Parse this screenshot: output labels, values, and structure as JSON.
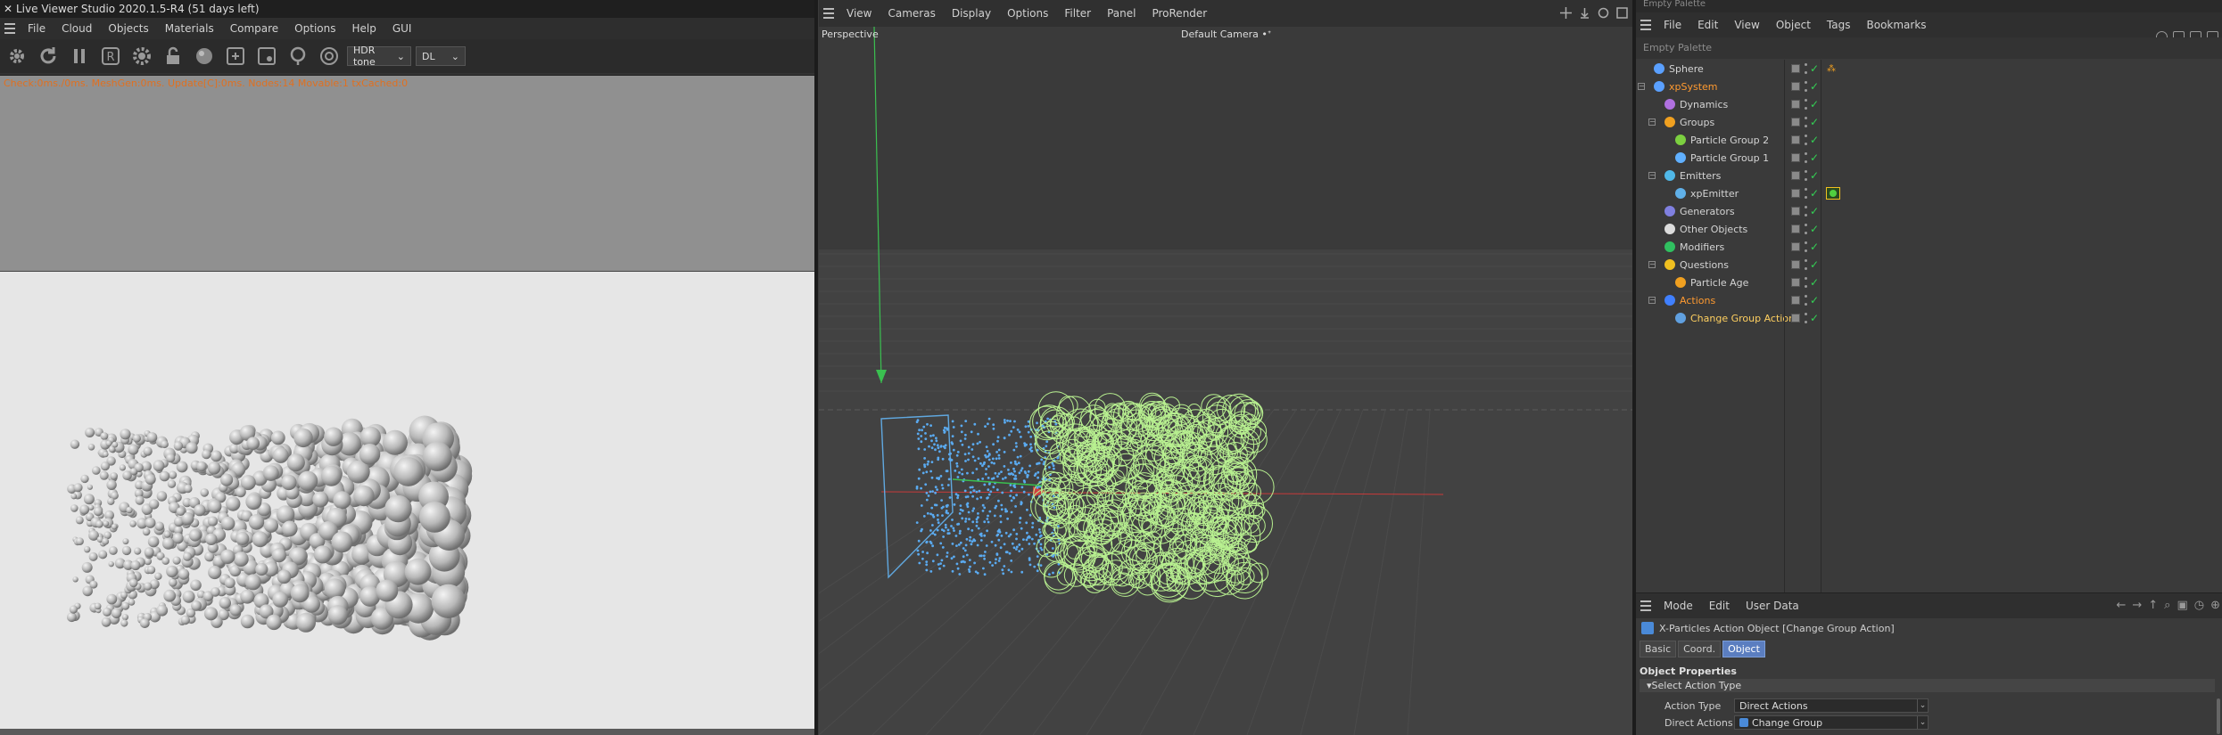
{
  "live_viewer": {
    "title": "Live Viewer Studio 2020.1.5-R4 (51 days left)",
    "menu": [
      "File",
      "Cloud",
      "Objects",
      "Materials",
      "Compare",
      "Options",
      "Help",
      "GUI"
    ],
    "tone_dropdown": "HDR tone",
    "mode_dropdown": "DL",
    "status": "Check:0ms./0ms. MeshGen:0ms. Update[C]:0ms. Nodes:14 Movable:1 txCached:0"
  },
  "viewport": {
    "menu": [
      "View",
      "Cameras",
      "Display",
      "Options",
      "Filter",
      "Panel",
      "ProRender"
    ],
    "projection": "Perspective",
    "camera": "Default Camera"
  },
  "object_manager": {
    "top_palette": "Empty Palette",
    "menu": [
      "File",
      "Edit",
      "View",
      "Object",
      "Tags",
      "Bookmarks"
    ],
    "palette": "Empty Palette",
    "objects": [
      {
        "name": "Sphere",
        "indent": 0,
        "color": "#5aa0ff"
      },
      {
        "name": "xpSystem",
        "indent": 0,
        "color": "#5aa0ff",
        "style": "orange"
      },
      {
        "name": "Dynamics",
        "indent": 1,
        "color": "#b070e0"
      },
      {
        "name": "Groups",
        "indent": 1,
        "color": "#f0a020"
      },
      {
        "name": "Particle Group 2",
        "indent": 2,
        "color": "#7cd040"
      },
      {
        "name": "Particle Group 1",
        "indent": 2,
        "color": "#60b0ff"
      },
      {
        "name": "Emitters",
        "indent": 1,
        "color": "#50b8e8"
      },
      {
        "name": "xpEmitter",
        "indent": 2,
        "color": "#60b0e8"
      },
      {
        "name": "Generators",
        "indent": 1,
        "color": "#8080e0"
      },
      {
        "name": "Other Objects",
        "indent": 1,
        "color": "#dcdcdc"
      },
      {
        "name": "Modifiers",
        "indent": 1,
        "color": "#30c060"
      },
      {
        "name": "Questions",
        "indent": 1,
        "color": "#f0c020"
      },
      {
        "name": "Particle Age",
        "indent": 2,
        "color": "#f0a020"
      },
      {
        "name": "Actions",
        "indent": 1,
        "color": "#4080ff",
        "style": "orange"
      },
      {
        "name": "Change Group Action",
        "indent": 2,
        "color": "#60a0e0",
        "style": "sel"
      }
    ]
  },
  "attributes": {
    "menu": [
      "Mode",
      "Edit",
      "User Data"
    ],
    "title": "X-Particles Action Object [Change Group Action]",
    "tabs": [
      "Basic",
      "Coord.",
      "Object"
    ],
    "active_tab": "Object",
    "section": "Object Properties",
    "group": "Select Action Type",
    "properties": [
      {
        "label": "Action Type",
        "value": "Direct Actions"
      },
      {
        "label": "Direct Actions",
        "value": "Change Group"
      }
    ]
  },
  "colors": {
    "accent": "#5b7ec0",
    "status_orange": "#e07020",
    "check_green": "#34d055",
    "particle_green": "#b8f090",
    "particle_blue": "#5aaaf0"
  }
}
